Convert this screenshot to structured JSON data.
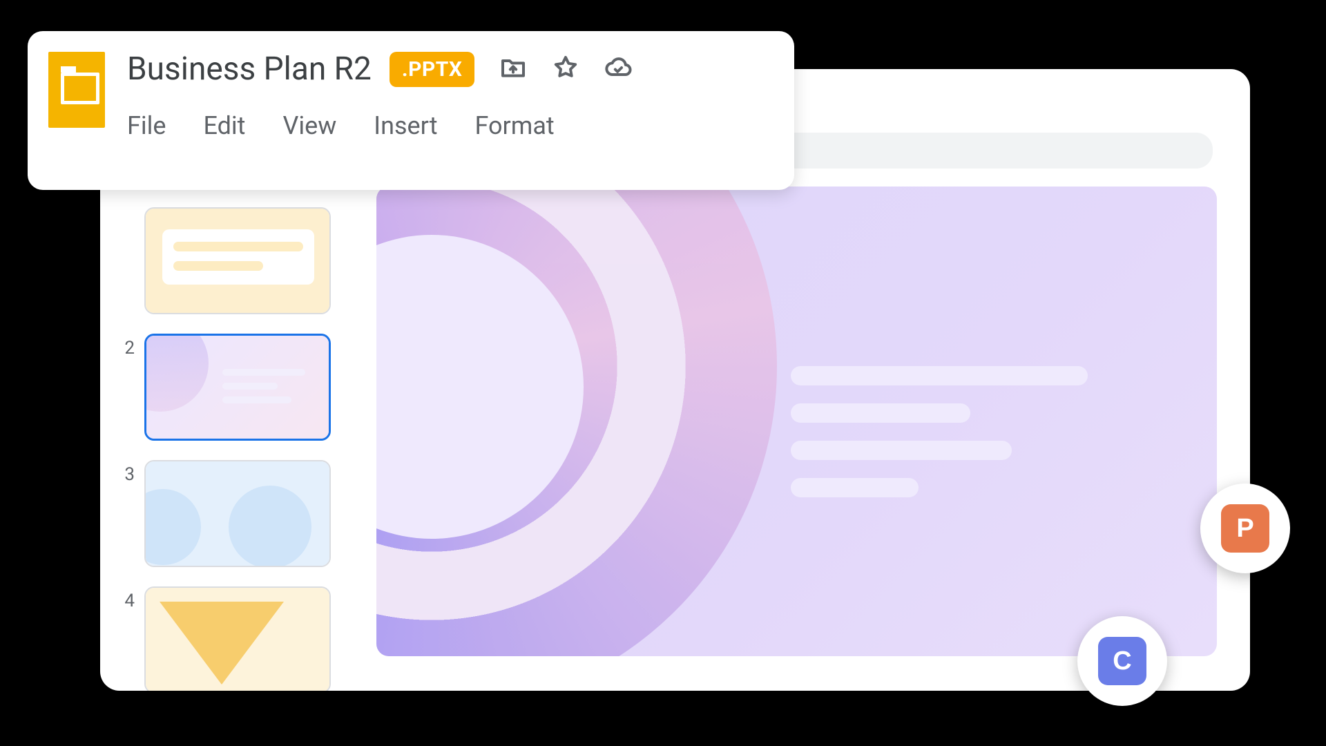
{
  "header": {
    "title": "Business Plan R2",
    "extension_badge": ".PPTX",
    "menu": [
      "File",
      "Edit",
      "View",
      "Insert",
      "Format"
    ]
  },
  "thumbnails": [
    {
      "number": "",
      "selected": false
    },
    {
      "number": "2",
      "selected": true
    },
    {
      "number": "3",
      "selected": false
    },
    {
      "number": "4",
      "selected": false
    }
  ],
  "collaborators": [
    {
      "initial": "P",
      "color": "#e8794b"
    },
    {
      "initial": "C",
      "color": "#6a7de8"
    }
  ]
}
